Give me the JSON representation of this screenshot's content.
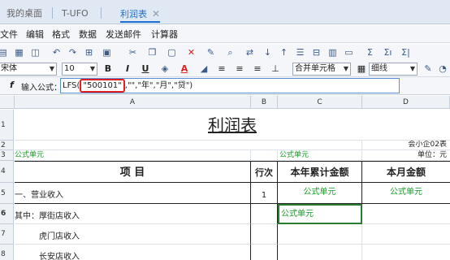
{
  "tabs": [
    {
      "label": "我的桌面",
      "active": false
    },
    {
      "label": "T-UFO",
      "active": false
    },
    {
      "label": "利润表",
      "active": true,
      "close": "✕"
    }
  ],
  "menu": [
    "文件",
    "编辑",
    "格式",
    "数据",
    "发送邮件",
    "计算器"
  ],
  "toolbar": {
    "font_name": "宋体",
    "font_size": "10",
    "bold": "B",
    "italic": "I",
    "underline": "U",
    "merge_combo": "合并单元格",
    "border_combo": "细线",
    "sum1": "Σ",
    "sum2": "Σı",
    "sum3": "Σ|"
  },
  "formula": {
    "label": "输入公式：",
    "prefix": "LFS(",
    "highlighted": "\"500101\"",
    "suffix": ",\"\",\"年\",\"月\",\"贷\")"
  },
  "columns": [
    "A",
    "B",
    "C",
    "D"
  ],
  "rows": [
    "1",
    "2",
    "3",
    "4",
    "5",
    "6",
    "7",
    "8"
  ],
  "sheet": {
    "title": "利润表",
    "r2_d": "会小企02表",
    "r3_a": "公式单元",
    "r3_c": "公式单元",
    "r3_d": "单位：元",
    "h_item": "项    目",
    "h_row": "行次",
    "h_year": "本年累计金额",
    "h_month": "本月金额",
    "r5_a": "一、营业收入",
    "r5_b": "1",
    "r5_c": "公式单元",
    "r5_d": "公式单元",
    "r6_a": "其中：厚街店收入",
    "r6_c": "公式单元",
    "r7_a": "虎门店收入",
    "r8_a": "长安店收入"
  },
  "colors": {
    "accent": "#1f6fd0",
    "formula_cell": "#1a9a2a",
    "highlight": "#e02020"
  }
}
